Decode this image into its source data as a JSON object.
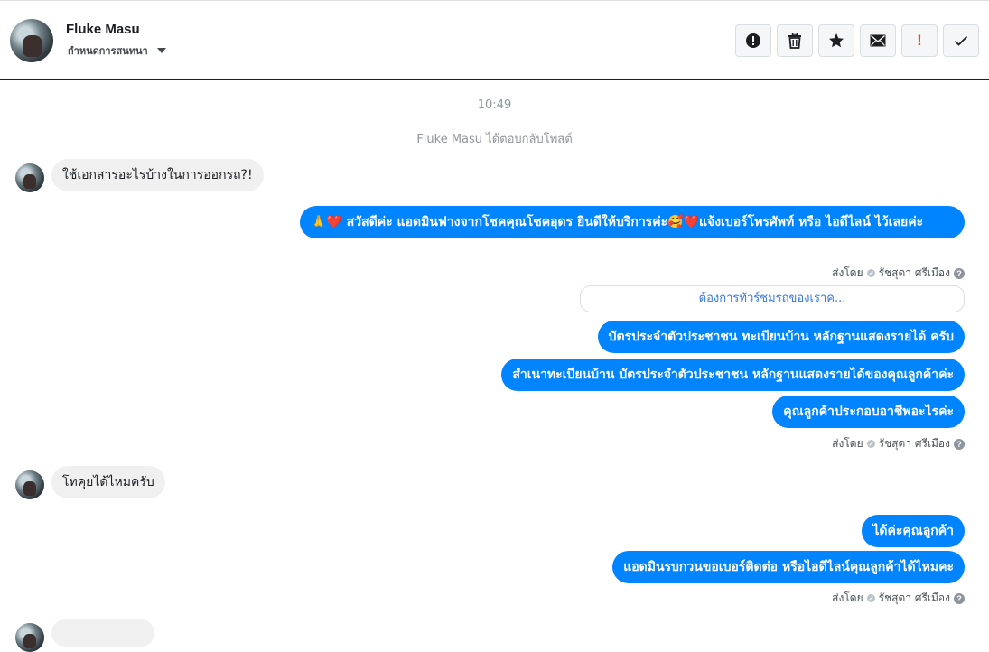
{
  "header": {
    "name": "Fluke Masu",
    "subtitle": "กำหนดการสนทนา",
    "toolbar_icons": [
      "report-icon",
      "trash-icon",
      "star-icon",
      "envelope-icon",
      "important-icon",
      "check-icon"
    ]
  },
  "thread": {
    "timestamp": "10:49",
    "system_note": "Fluke Masu ได้ตอบกลับโพสต์",
    "incoming_1": "ใช้เอกสารอะไรบ้างในการออกรถ?!",
    "outgoing_1": {
      "emoji_prefix": "🙏❤️",
      "text": "สวัสดีค่ะ แอดมินฟางจากโชคคุณโชคอุดร ยินดีให้บริการค่ะ🥰❤️แจ้งเบอร์โทรศัพท์ หรือ ไอดีไลน์  ไว้เลยค่ะ"
    },
    "sent_by_label": "ส่งโดย",
    "sender_name": "รัชสุดา ศรีเมือง",
    "quick_reply": "ต้องการทัวร์ชมรถของเราค...",
    "outgoing_2": "บัตรประจำตัวประชาชน ทะเบียนบ้าน หลักฐานแสดงรายได้ ครับ",
    "outgoing_3": "สำเนาทะเบียนบ้าน บัตรประจำตัวประชาชน หลักฐานแสดงรายได้ของคุณลูกค้าค่ะ",
    "outgoing_4": "คุณลูกค้าประกอบอาชีพอะไรค่ะ",
    "incoming_2": "โทคุยได้ไหมครับ",
    "outgoing_5": "ได้ค่ะคุณลูกค้า",
    "outgoing_6": "แอดมินรบกวนขอเบอร์ติดต่อ หรือไอดีไลน์คุณลูกค้าได้ไหมคะ"
  },
  "colors": {
    "outgoing_bubble": "#0084ff",
    "incoming_bubble": "#f1f0f0",
    "important_red": "#fa3e3e",
    "link_blue": "#3578e5"
  }
}
